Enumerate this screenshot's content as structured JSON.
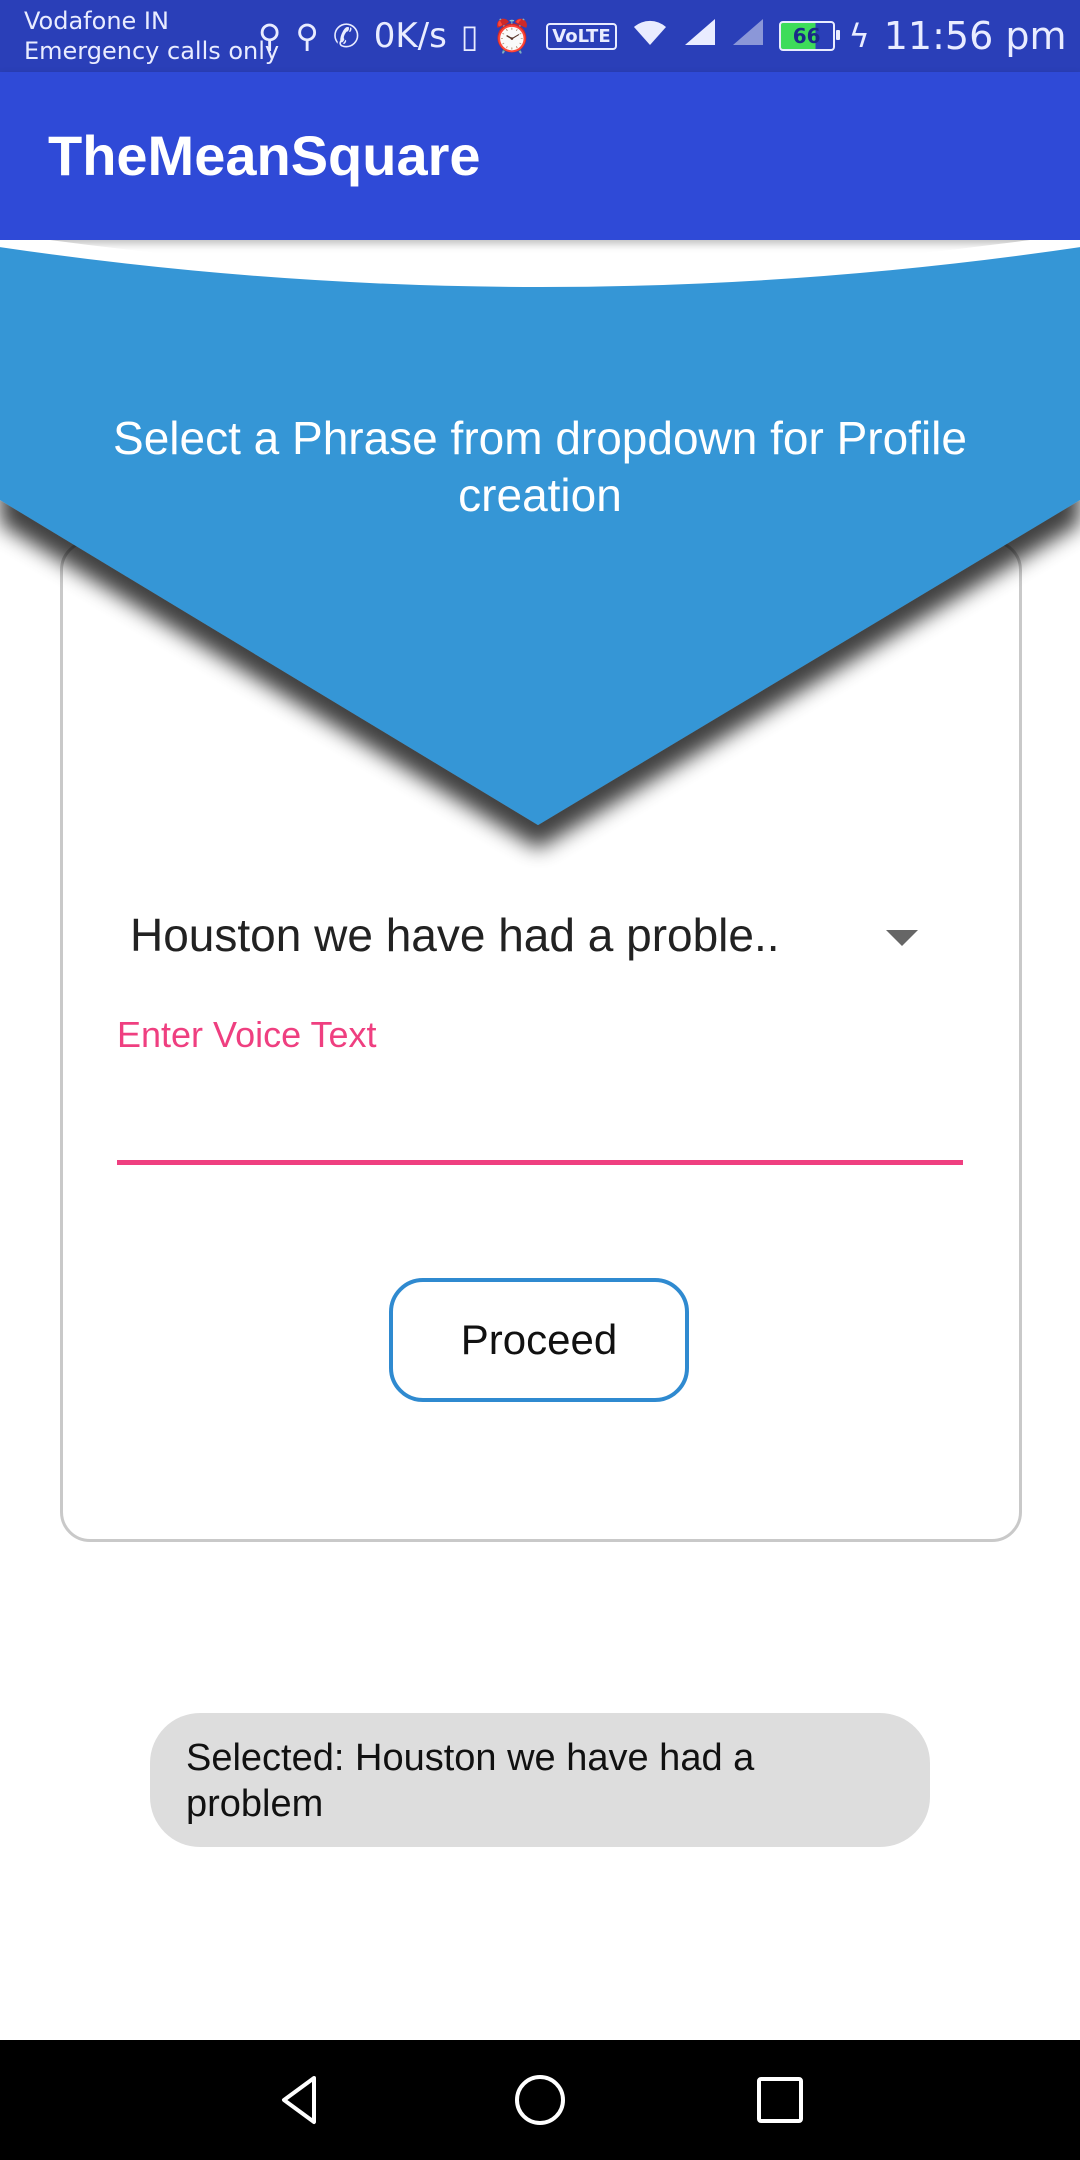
{
  "status_bar": {
    "carrier": "Vodafone IN",
    "emergency": "Emergency calls only",
    "speed": "0K/s",
    "volte": "VoLTE",
    "battery": "66",
    "time": "11:56 pm"
  },
  "app_bar": {
    "title": "TheMeanSquare"
  },
  "banner": {
    "text": "Select a Phrase from dropdown for Profile creation"
  },
  "form": {
    "phrase_selected": "Houston we have had a proble..",
    "voice_label": "Enter Voice Text",
    "voice_value": "",
    "proceed_label": "Proceed"
  },
  "toast": {
    "text": "Selected: Houston we have had a problem"
  },
  "colors": {
    "app_bar": "#2f4ad7",
    "status_bar": "#2a3fb8",
    "banner": "#3596d6",
    "accent_pink": "#ef3f80",
    "button_border": "#2f8ad0"
  },
  "icons": {
    "status": [
      "usb-icon",
      "usb-icon",
      "whatsapp-icon",
      "vibrate-icon",
      "alarm-icon",
      "volte-icon",
      "wifi-icon",
      "signal-icon",
      "signal-icon",
      "battery-icon",
      "charging-icon"
    ],
    "nav": [
      "back-icon",
      "home-icon",
      "recents-icon"
    ]
  }
}
